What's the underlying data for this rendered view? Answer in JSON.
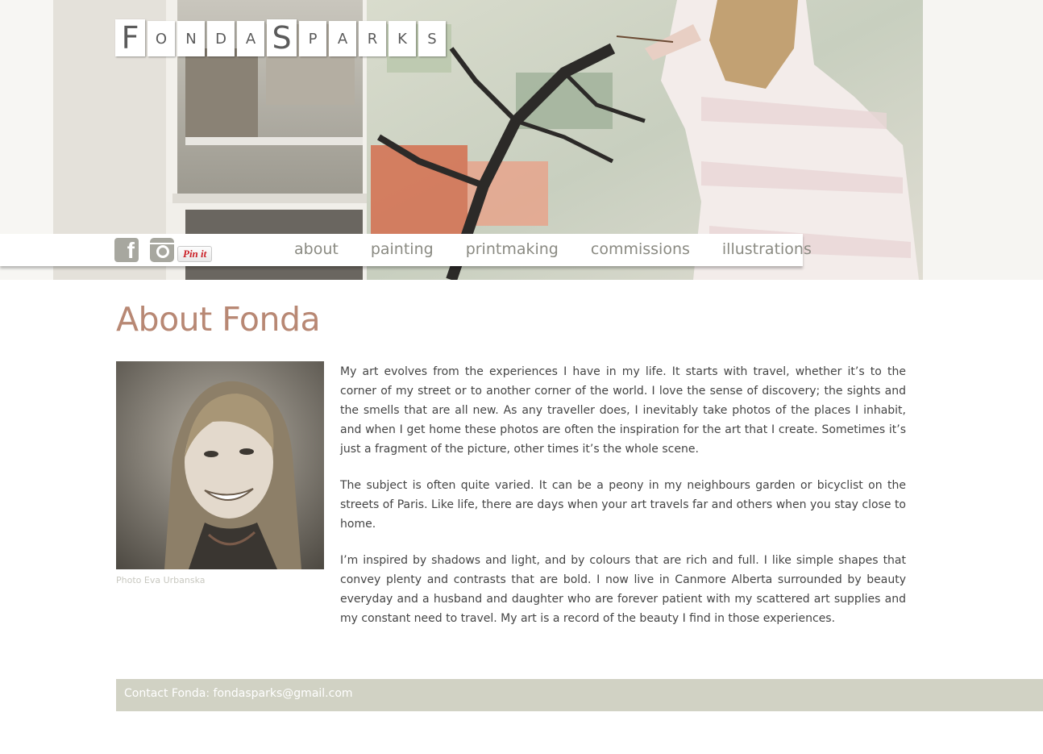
{
  "site": {
    "logo_letters": [
      "F",
      "o",
      "n",
      "d",
      "a",
      "S",
      "p",
      "a",
      "r",
      "k",
      "s"
    ],
    "logo_text": "FondaSparks"
  },
  "social": {
    "facebook_icon": "facebook-icon",
    "instagram_icon": "instagram-icon",
    "pin_label": "Pin it"
  },
  "nav": {
    "items": [
      {
        "label": "about"
      },
      {
        "label": "painting"
      },
      {
        "label": "printmaking"
      },
      {
        "label": "commissions"
      },
      {
        "label": "illustrations"
      }
    ]
  },
  "page": {
    "title": "About Fonda",
    "photo_caption": "Photo Eva Urbanska",
    "paragraphs": [
      "My art evolves from the experiences I have in my life. It starts with travel, whether it’s to the corner of my street or to another corner of the world. I love the sense of discovery; the sights and the smells that are all new. As any traveller does, I inevitably take photos of the places I inhabit, and when I get home these photos are often the inspiration for the art that I create. Sometimes it’s just a fragment of the picture, other times it’s the whole scene.",
      "The subject is often quite varied. It can be a peony in my neighbours garden or bicyclist on the streets of Paris.  Like life, there are days when your art travels far and others when you stay close to home.",
      "I’m inspired by shadows and light, and by colours that are rich and full. I like simple shapes that convey plenty and contrasts that are bold.  I now live in Canmore Alberta surrounded by beauty everyday and a husband and daughter who are forever patient with my scattered art supplies and my constant need to travel.  My art is a record of the beauty I find in those experiences."
    ]
  },
  "footer": {
    "contact_text": "Contact Fonda: fondasparks@gmail.com"
  },
  "colors": {
    "title": "#b88874",
    "nav_text": "#8a8a82",
    "footer_bg": "#d1d2c4",
    "icon_gray": "#a7a79f"
  }
}
